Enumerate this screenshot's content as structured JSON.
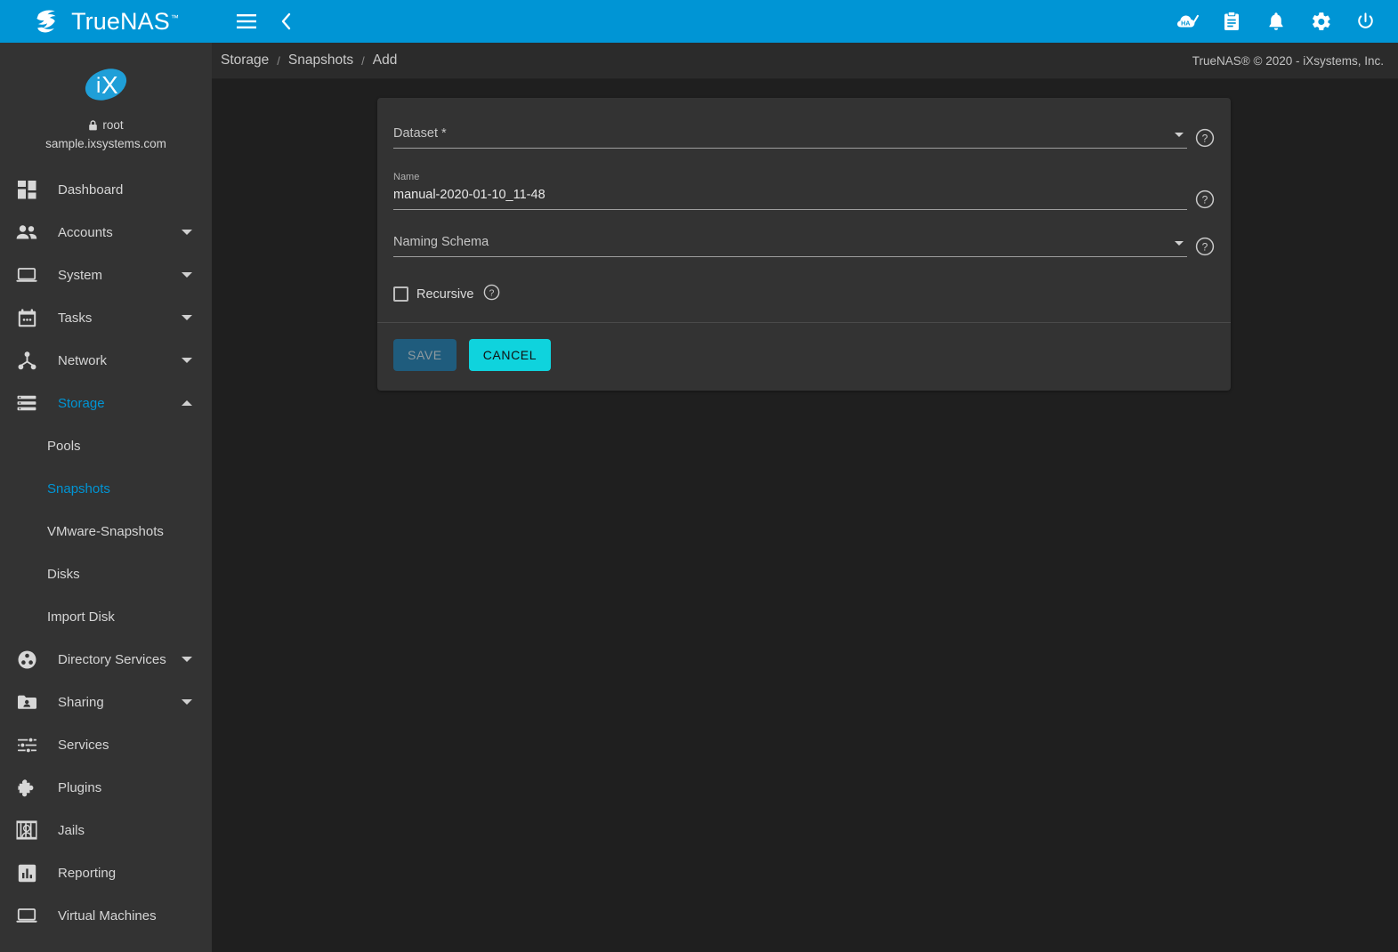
{
  "topbar": {
    "brand_name": "TrueNAS",
    "brand_tm": "™",
    "logo_icon": "truenas-logo-icon",
    "menu_toggle_icon": "hamburger-menu-icon",
    "back_icon": "chevron-left-icon",
    "right_icons": [
      {
        "name": "ha-status-icon",
        "label": "HA"
      },
      {
        "name": "jobs-clipboard-icon",
        "label": ""
      },
      {
        "name": "notifications-bell-icon",
        "label": ""
      },
      {
        "name": "settings-gear-icon",
        "label": ""
      },
      {
        "name": "power-icon",
        "label": ""
      }
    ],
    "accent_color": "#0095d5"
  },
  "sidebar": {
    "logo_text": "iX",
    "username": "root",
    "hostname": "sample.ixsystems.com",
    "lock_icon": "lock-icon",
    "items": [
      {
        "label": "Dashboard",
        "icon": "dashboard-grid-icon",
        "expandable": false,
        "active": false
      },
      {
        "label": "Accounts",
        "icon": "accounts-people-icon",
        "expandable": true,
        "active": false
      },
      {
        "label": "System",
        "icon": "system-laptop-icon",
        "expandable": true,
        "active": false
      },
      {
        "label": "Tasks",
        "icon": "tasks-calendar-icon",
        "expandable": true,
        "active": false
      },
      {
        "label": "Network",
        "icon": "network-nodes-icon",
        "expandable": true,
        "active": false
      },
      {
        "label": "Storage",
        "icon": "storage-server-icon",
        "expandable": true,
        "active": true,
        "expanded": true
      },
      {
        "label": "Directory Services",
        "icon": "directory-services-icon",
        "expandable": true,
        "active": false
      },
      {
        "label": "Sharing",
        "icon": "sharing-folder-icon",
        "expandable": true,
        "active": false
      },
      {
        "label": "Services",
        "icon": "services-sliders-icon",
        "expandable": false,
        "active": false
      },
      {
        "label": "Plugins",
        "icon": "plugins-puzzle-icon",
        "expandable": false,
        "active": false
      },
      {
        "label": "Jails",
        "icon": "jails-icon",
        "expandable": false,
        "active": false
      },
      {
        "label": "Reporting",
        "icon": "reporting-chart-icon",
        "expandable": false,
        "active": false
      },
      {
        "label": "Virtual Machines",
        "icon": "virtual-machines-monitor-icon",
        "expandable": false,
        "active": false
      }
    ],
    "storage_subitems": [
      {
        "label": "Pools",
        "active": false
      },
      {
        "label": "Snapshots",
        "active": true
      },
      {
        "label": "VMware-Snapshots",
        "active": false
      },
      {
        "label": "Disks",
        "active": false
      },
      {
        "label": "Import Disk",
        "active": false
      }
    ]
  },
  "breadcrumb": {
    "items": [
      "Storage",
      "Snapshots",
      "Add"
    ],
    "separator": "/",
    "copyright": "TrueNAS® © 2020 - iXsystems, Inc."
  },
  "form": {
    "dataset": {
      "label": "Dataset *",
      "value": "",
      "help_icon": "help-circle-icon",
      "dropdown_icon": "dropdown-arrow-icon"
    },
    "name": {
      "label": "Name",
      "value": "manual-2020-01-10_11-48",
      "help_icon": "help-circle-icon"
    },
    "naming_schema": {
      "label": "Naming Schema",
      "value": "",
      "help_icon": "help-circle-icon",
      "dropdown_icon": "dropdown-arrow-icon"
    },
    "recursive": {
      "label": "Recursive",
      "checked": false,
      "help_icon": "help-circle-icon"
    },
    "save_label": "SAVE",
    "cancel_label": "CANCEL",
    "save_color": "#1f5c7d",
    "cancel_color": "#0fd3dd"
  }
}
